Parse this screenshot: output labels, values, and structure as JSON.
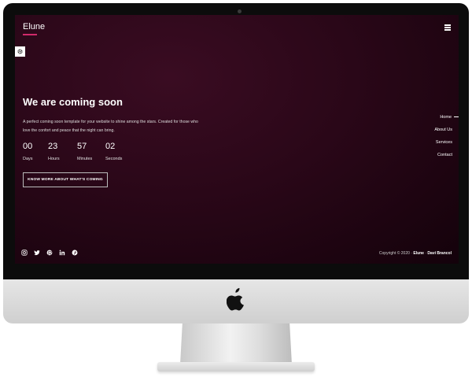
{
  "brand": {
    "name": "Elune",
    "accent": "#d02a6a"
  },
  "hero": {
    "title": "We are coming soon",
    "description": "A perfect coming soon template for your website to shine among the stars. Created for those who love the confort and peace that the night can bring.",
    "countdown": [
      {
        "value": "00",
        "label": "Days"
      },
      {
        "value": "23",
        "label": "Hours"
      },
      {
        "value": "57",
        "label": "Minutes"
      },
      {
        "value": "02",
        "label": "Seconds"
      }
    ],
    "cta_label": "KNOW MORE ABOUT WHAT'S COMING"
  },
  "nav": {
    "items": [
      {
        "label": "Home",
        "active": true
      },
      {
        "label": "About Us"
      },
      {
        "label": "Services"
      },
      {
        "label": "Contact"
      }
    ]
  },
  "socials": [
    "instagram-icon",
    "twitter-icon",
    "github-icon",
    "linkedin-icon",
    "pinterest-icon"
  ],
  "footer": {
    "copyright_prefix": "Copyright © 2020 · ",
    "brand": "Elune",
    "separator": " · ",
    "author": "Davi Brancol"
  },
  "icons": {
    "menu": "hamburger-menu-icon",
    "settings": "gear-icon",
    "device_logo": "apple-logo"
  },
  "colors": {
    "screen_bg": "#2a0718",
    "text": "#ffffff"
  }
}
